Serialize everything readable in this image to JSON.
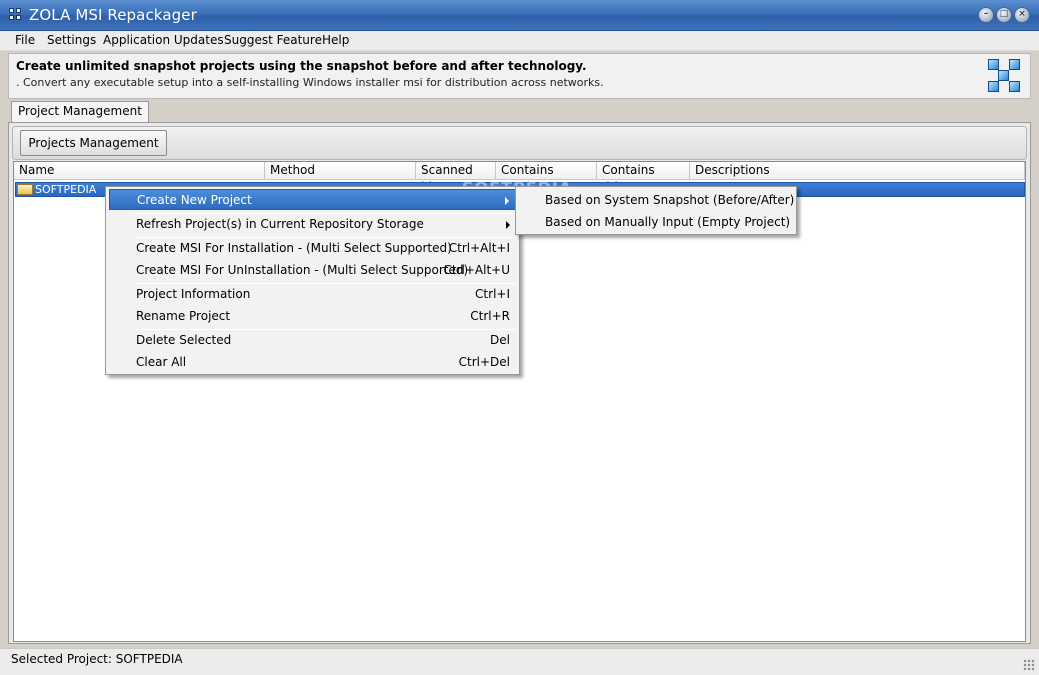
{
  "window": {
    "title": "ZOLA MSI Repackager"
  },
  "menu": [
    "File",
    "Settings",
    "Application Updates",
    "Suggest Feature",
    "Help"
  ],
  "banner": {
    "title": "Create unlimited snapshot projects using the snapshot before and after technology.",
    "subtitle": ". Convert any executable setup into a self-installing Windows installer msi for distribution across networks."
  },
  "tabs": {
    "active": "Project Management"
  },
  "toolbar": {
    "projects_button": "Projects Management"
  },
  "list": {
    "columns": [
      "Name",
      "Method",
      "Scanned bits",
      "Contains services",
      "Contains drivers",
      "Descriptions"
    ],
    "rows": [
      {
        "name": "SOFTPEDIA"
      }
    ]
  },
  "context_menu": [
    {
      "label": "Create New Project",
      "shortcut": ""
    },
    {
      "label": "Refresh Project(s) in Current Repository Storage",
      "shortcut": ""
    },
    {
      "label": "Create MSI For Installation - (Multi Select Supported)",
      "shortcut": "Ctrl+Alt+I"
    },
    {
      "label": "Create MSI For UnInstallation - (Multi Select Supported)",
      "shortcut": "Ctrl+Alt+U"
    },
    {
      "label": "Project Information",
      "shortcut": "Ctrl+I"
    },
    {
      "label": "Rename Project",
      "shortcut": "Ctrl+R"
    },
    {
      "label": "Delete Selected",
      "shortcut": "Del"
    },
    {
      "label": "Clear All",
      "shortcut": "Ctrl+Del"
    }
  ],
  "submenu": [
    "Based on System Snapshot (Before/After)",
    "Based on Manually Input (Empty Project)"
  ],
  "watermark": "SOFTPEDIA",
  "status": {
    "text": "Selected Project: SOFTPEDIA"
  }
}
